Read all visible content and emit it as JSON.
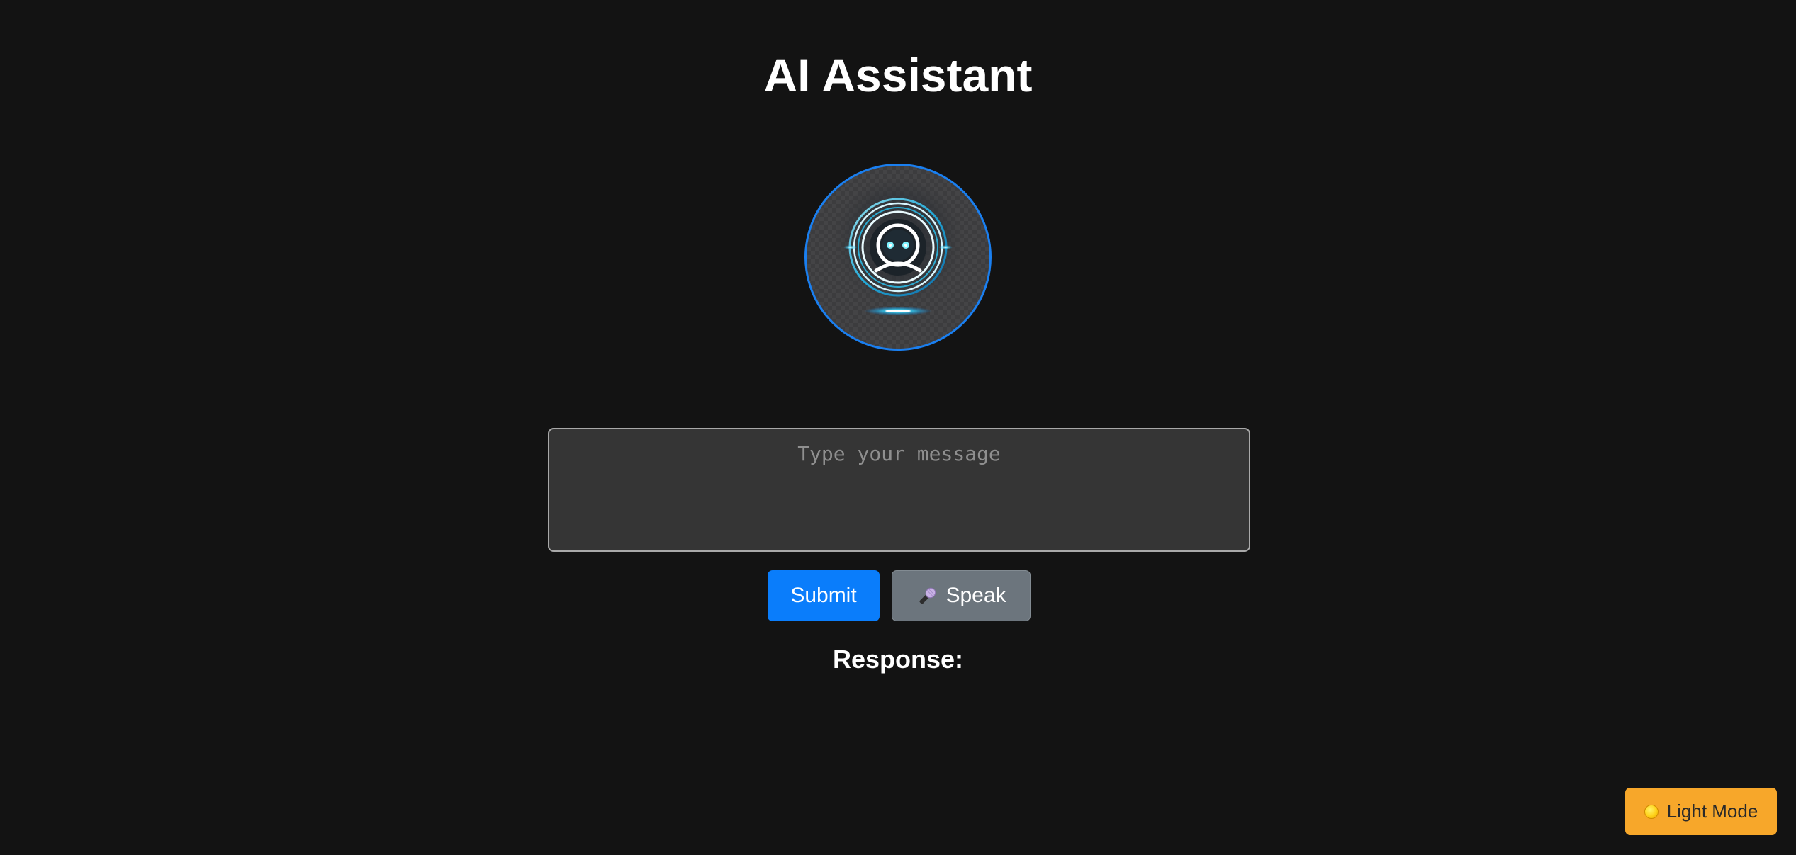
{
  "header": {
    "title": "AI Assistant"
  },
  "avatar": {
    "icon": "robot-assistant-icon",
    "ring_color": "#1a7ff0"
  },
  "input": {
    "placeholder": "Type your message",
    "value": ""
  },
  "actions": {
    "submit_label": "Submit",
    "speak_label": "Speak",
    "speak_icon": "microphone-icon",
    "submit_color": "#0a7dfb",
    "speak_color": "#6c757d"
  },
  "response": {
    "heading": "Response:",
    "text": ""
  },
  "theme_toggle": {
    "label": "Light Mode",
    "icon": "sun-icon",
    "color": "#f7a72a"
  },
  "colors": {
    "background": "#131313",
    "text": "#ffffff"
  }
}
